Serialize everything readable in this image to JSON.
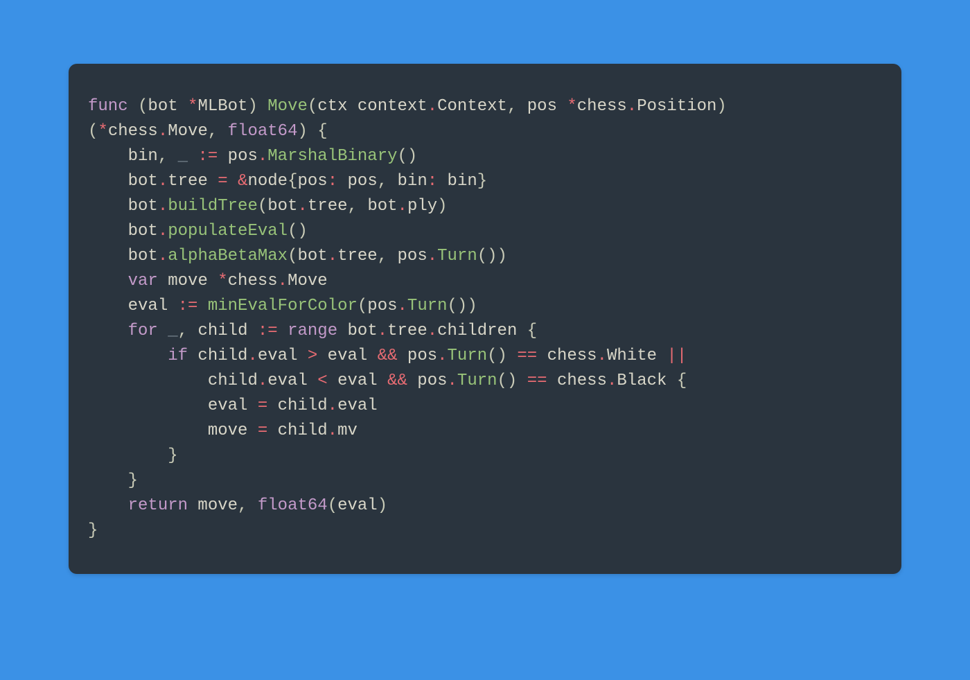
{
  "language": "go",
  "theme": "dark-one",
  "background": "#3b91e6",
  "panel_bg": "#2a343e",
  "colors": {
    "keyword": "#c39ac9",
    "operator_punct": "#e86c73",
    "function": "#98c379",
    "identifier": "#d8d6c8",
    "dim": "#7f8c96"
  },
  "raw_code": "func (bot *MLBot) Move(ctx context.Context, pos *chess.Position)\n(*chess.Move, float64) {\n    bin, _ := pos.MarshalBinary()\n    bot.tree = &node{pos: pos, bin: bin}\n    bot.buildTree(bot.tree, bot.ply)\n    bot.populateEval()\n    bot.alphaBetaMax(bot.tree, pos.Turn())\n    var move *chess.Move\n    eval := minEvalForColor(pos.Turn())\n    for _, child := range bot.tree.children {\n        if child.eval > eval && pos.Turn() == chess.White ||\n            child.eval < eval && pos.Turn() == chess.Black {\n            eval = child.eval\n            move = child.mv\n        }\n    }\n    return move, float64(eval)\n}",
  "tokens": [
    [
      {
        "c": "kw",
        "t": "func"
      },
      {
        "c": "pn",
        "t": " ("
      },
      {
        "c": "",
        "t": "bot "
      },
      {
        "c": "op",
        "t": "*"
      },
      {
        "c": "",
        "t": "MLBot"
      },
      {
        "c": "pn",
        "t": ") "
      },
      {
        "c": "fn",
        "t": "Move"
      },
      {
        "c": "pn",
        "t": "("
      },
      {
        "c": "",
        "t": "ctx context"
      },
      {
        "c": "op",
        "t": "."
      },
      {
        "c": "",
        "t": "Context"
      },
      {
        "c": "pn",
        "t": ", "
      },
      {
        "c": "",
        "t": "pos "
      },
      {
        "c": "op",
        "t": "*"
      },
      {
        "c": "",
        "t": "chess"
      },
      {
        "c": "op",
        "t": "."
      },
      {
        "c": "",
        "t": "Position"
      },
      {
        "c": "pn",
        "t": ")"
      }
    ],
    [
      {
        "c": "pn",
        "t": "("
      },
      {
        "c": "op",
        "t": "*"
      },
      {
        "c": "",
        "t": "chess"
      },
      {
        "c": "op",
        "t": "."
      },
      {
        "c": "",
        "t": "Move"
      },
      {
        "c": "pn",
        "t": ", "
      },
      {
        "c": "kw",
        "t": "float64"
      },
      {
        "c": "pn",
        "t": ") {"
      }
    ],
    [
      {
        "c": "",
        "t": "    bin"
      },
      {
        "c": "pn",
        "t": ", "
      },
      {
        "c": "dim",
        "t": "_"
      },
      {
        "c": "",
        "t": " "
      },
      {
        "c": "op",
        "t": ":="
      },
      {
        "c": "",
        "t": " pos"
      },
      {
        "c": "op",
        "t": "."
      },
      {
        "c": "fn",
        "t": "MarshalBinary"
      },
      {
        "c": "pn",
        "t": "()"
      }
    ],
    [
      {
        "c": "",
        "t": "    bot"
      },
      {
        "c": "op",
        "t": "."
      },
      {
        "c": "",
        "t": "tree "
      },
      {
        "c": "op",
        "t": "="
      },
      {
        "c": "",
        "t": " "
      },
      {
        "c": "op",
        "t": "&"
      },
      {
        "c": "",
        "t": "node"
      },
      {
        "c": "pn",
        "t": "{"
      },
      {
        "c": "",
        "t": "pos"
      },
      {
        "c": "op",
        "t": ":"
      },
      {
        "c": "",
        "t": " pos"
      },
      {
        "c": "pn",
        "t": ", "
      },
      {
        "c": "",
        "t": "bin"
      },
      {
        "c": "op",
        "t": ":"
      },
      {
        "c": "",
        "t": " bin"
      },
      {
        "c": "pn",
        "t": "}"
      }
    ],
    [
      {
        "c": "",
        "t": "    bot"
      },
      {
        "c": "op",
        "t": "."
      },
      {
        "c": "fn",
        "t": "buildTree"
      },
      {
        "c": "pn",
        "t": "("
      },
      {
        "c": "",
        "t": "bot"
      },
      {
        "c": "op",
        "t": "."
      },
      {
        "c": "",
        "t": "tree"
      },
      {
        "c": "pn",
        "t": ", "
      },
      {
        "c": "",
        "t": "bot"
      },
      {
        "c": "op",
        "t": "."
      },
      {
        "c": "",
        "t": "ply"
      },
      {
        "c": "pn",
        "t": ")"
      }
    ],
    [
      {
        "c": "",
        "t": "    bot"
      },
      {
        "c": "op",
        "t": "."
      },
      {
        "c": "fn",
        "t": "populateEval"
      },
      {
        "c": "pn",
        "t": "()"
      }
    ],
    [
      {
        "c": "",
        "t": "    bot"
      },
      {
        "c": "op",
        "t": "."
      },
      {
        "c": "fn",
        "t": "alphaBetaMax"
      },
      {
        "c": "pn",
        "t": "("
      },
      {
        "c": "",
        "t": "bot"
      },
      {
        "c": "op",
        "t": "."
      },
      {
        "c": "",
        "t": "tree"
      },
      {
        "c": "pn",
        "t": ", "
      },
      {
        "c": "",
        "t": "pos"
      },
      {
        "c": "op",
        "t": "."
      },
      {
        "c": "fn",
        "t": "Turn"
      },
      {
        "c": "pn",
        "t": "())"
      }
    ],
    [
      {
        "c": "",
        "t": "    "
      },
      {
        "c": "kw",
        "t": "var"
      },
      {
        "c": "",
        "t": " move "
      },
      {
        "c": "op",
        "t": "*"
      },
      {
        "c": "",
        "t": "chess"
      },
      {
        "c": "op",
        "t": "."
      },
      {
        "c": "",
        "t": "Move"
      }
    ],
    [
      {
        "c": "",
        "t": "    eval "
      },
      {
        "c": "op",
        "t": ":="
      },
      {
        "c": "",
        "t": " "
      },
      {
        "c": "fn",
        "t": "minEvalForColor"
      },
      {
        "c": "pn",
        "t": "("
      },
      {
        "c": "",
        "t": "pos"
      },
      {
        "c": "op",
        "t": "."
      },
      {
        "c": "fn",
        "t": "Turn"
      },
      {
        "c": "pn",
        "t": "())"
      }
    ],
    [
      {
        "c": "",
        "t": "    "
      },
      {
        "c": "kw",
        "t": "for"
      },
      {
        "c": "",
        "t": " "
      },
      {
        "c": "dim",
        "t": "_"
      },
      {
        "c": "pn",
        "t": ", "
      },
      {
        "c": "",
        "t": "child "
      },
      {
        "c": "op",
        "t": ":="
      },
      {
        "c": "",
        "t": " "
      },
      {
        "c": "kw",
        "t": "range"
      },
      {
        "c": "",
        "t": " bot"
      },
      {
        "c": "op",
        "t": "."
      },
      {
        "c": "",
        "t": "tree"
      },
      {
        "c": "op",
        "t": "."
      },
      {
        "c": "",
        "t": "children "
      },
      {
        "c": "pn",
        "t": "{"
      }
    ],
    [
      {
        "c": "",
        "t": "        "
      },
      {
        "c": "kw",
        "t": "if"
      },
      {
        "c": "",
        "t": " child"
      },
      {
        "c": "op",
        "t": "."
      },
      {
        "c": "",
        "t": "eval "
      },
      {
        "c": "op",
        "t": ">"
      },
      {
        "c": "",
        "t": " eval "
      },
      {
        "c": "op",
        "t": "&&"
      },
      {
        "c": "",
        "t": " pos"
      },
      {
        "c": "op",
        "t": "."
      },
      {
        "c": "fn",
        "t": "Turn"
      },
      {
        "c": "pn",
        "t": "() "
      },
      {
        "c": "op",
        "t": "=="
      },
      {
        "c": "",
        "t": " chess"
      },
      {
        "c": "op",
        "t": "."
      },
      {
        "c": "",
        "t": "White "
      },
      {
        "c": "op",
        "t": "||"
      }
    ],
    [
      {
        "c": "",
        "t": "            child"
      },
      {
        "c": "op",
        "t": "."
      },
      {
        "c": "",
        "t": "eval "
      },
      {
        "c": "op",
        "t": "<"
      },
      {
        "c": "",
        "t": " eval "
      },
      {
        "c": "op",
        "t": "&&"
      },
      {
        "c": "",
        "t": " pos"
      },
      {
        "c": "op",
        "t": "."
      },
      {
        "c": "fn",
        "t": "Turn"
      },
      {
        "c": "pn",
        "t": "() "
      },
      {
        "c": "op",
        "t": "=="
      },
      {
        "c": "",
        "t": " chess"
      },
      {
        "c": "op",
        "t": "."
      },
      {
        "c": "",
        "t": "Black "
      },
      {
        "c": "pn",
        "t": "{"
      }
    ],
    [
      {
        "c": "",
        "t": "            eval "
      },
      {
        "c": "op",
        "t": "="
      },
      {
        "c": "",
        "t": " child"
      },
      {
        "c": "op",
        "t": "."
      },
      {
        "c": "",
        "t": "eval"
      }
    ],
    [
      {
        "c": "",
        "t": "            move "
      },
      {
        "c": "op",
        "t": "="
      },
      {
        "c": "",
        "t": " child"
      },
      {
        "c": "op",
        "t": "."
      },
      {
        "c": "",
        "t": "mv"
      }
    ],
    [
      {
        "c": "pn",
        "t": "        }"
      }
    ],
    [
      {
        "c": "pn",
        "t": "    }"
      }
    ],
    [
      {
        "c": "",
        "t": "    "
      },
      {
        "c": "kw",
        "t": "return"
      },
      {
        "c": "",
        "t": " move"
      },
      {
        "c": "pn",
        "t": ", "
      },
      {
        "c": "kw",
        "t": "float64"
      },
      {
        "c": "pn",
        "t": "("
      },
      {
        "c": "",
        "t": "eval"
      },
      {
        "c": "pn",
        "t": ")"
      }
    ],
    [
      {
        "c": "pn",
        "t": "}"
      }
    ]
  ]
}
